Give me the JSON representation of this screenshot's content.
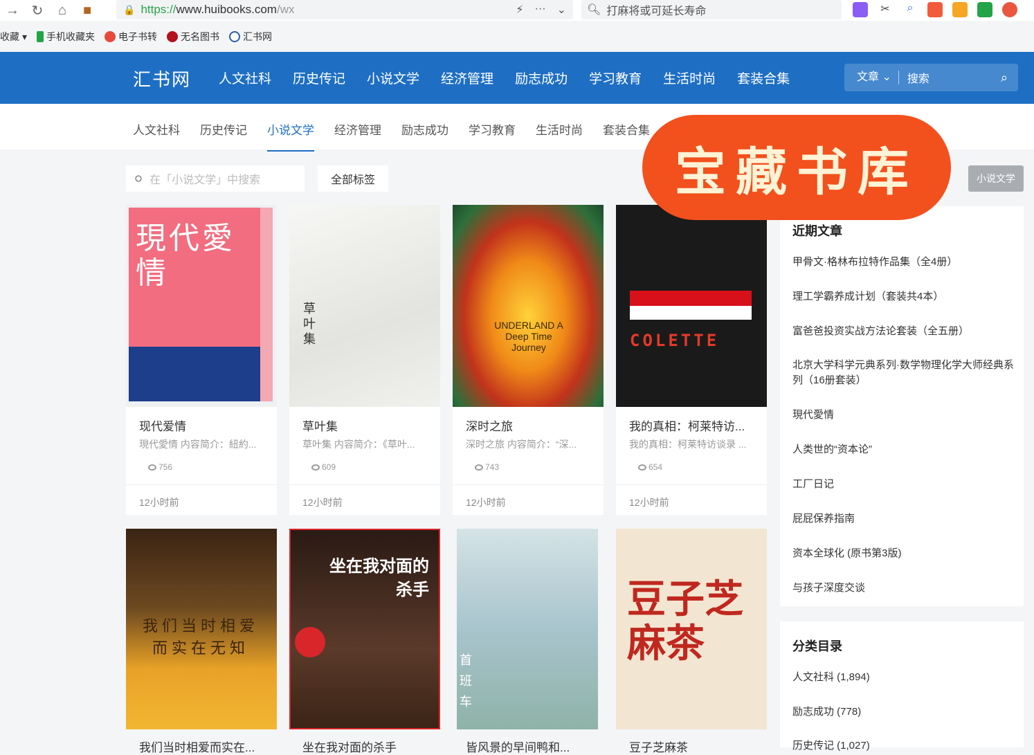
{
  "browser": {
    "url_scheme": "https://",
    "url_host": "www.huibooks.com",
    "url_path": "/wx",
    "search_text": "打麻将或可延长寿命",
    "bookmarks": [
      "收藏",
      "手机收藏夹",
      "电子书转",
      "无名图书",
      "汇书网"
    ]
  },
  "site": {
    "logo": "汇书网",
    "top_nav": [
      "人文社科",
      "历史传记",
      "小说文学",
      "经济管理",
      "励志成功",
      "学习教育",
      "生活时尚",
      "套装合集"
    ],
    "search_category": "文章 ⌄",
    "search_label": "搜索"
  },
  "subnav": {
    "items": [
      "人文社科",
      "历史传记",
      "小说文学",
      "经济管理",
      "励志成功",
      "学习教育",
      "生活时尚",
      "套装合集"
    ],
    "active_index": 2
  },
  "banner": {
    "text": "宝藏书库"
  },
  "category_badge": "小说文学",
  "filter": {
    "search_placeholder": "在「小说文学」中搜索",
    "all_tags": "全部标签"
  },
  "books": [
    {
      "title": "现代爱情",
      "desc": "現代愛情 内容简介：紐約...",
      "views": "756",
      "time": "12小时前",
      "cover_text": "現代愛情"
    },
    {
      "title": "草叶集",
      "desc": "草叶集 内容简介：《草叶...",
      "views": "609",
      "time": "12小时前",
      "cover_text": "草叶集"
    },
    {
      "title": "深时之旅",
      "desc": "深时之旅 内容简介：“深...",
      "views": "743",
      "time": "12小时前",
      "cover_text": "UNDERLAND A Deep Time Journey"
    },
    {
      "title": "我的真相：柯莱特访...",
      "desc": "我的真相：柯莱特访谈录 ...",
      "views": "654",
      "time": "12小时前",
      "cover_text": "COLETTE"
    }
  ],
  "books_row2": [
    {
      "title": "我们当时相爱而实在...",
      "cover_text": "我们当时相爱 而实在无知"
    },
    {
      "title": "坐在我对面的杀手",
      "cover_text": "坐在我对面的杀手"
    },
    {
      "title": "皆风景的早间鸭和...",
      "cover_text": "首班车"
    },
    {
      "title": "豆子芝麻茶",
      "cover_text": "豆子芝麻茶"
    }
  ],
  "sidebar": {
    "recent_title": "近期文章",
    "recent": [
      "甲骨文·格林布拉特作品集（全4册）",
      "理工学霸养成计划（套装共4本）",
      "富爸爸投资实战方法论套装（全五册）",
      "北京大学科学元典系列·数学物理化学大师经典系列（16册套装）",
      "現代愛情",
      "人类世的“资本论”",
      "工厂日记",
      "屁屁保养指南",
      "资本全球化 (原书第3版)",
      "与孩子深度交谈"
    ],
    "category_title": "分类目录",
    "categories": [
      "人文社科 (1,894)",
      "励志成功 (778)",
      "历史传记 (1,027)"
    ]
  },
  "colors": {
    "brand": "#1e6fc4",
    "banner": "#f2501d",
    "active": "#1e6fc4"
  }
}
